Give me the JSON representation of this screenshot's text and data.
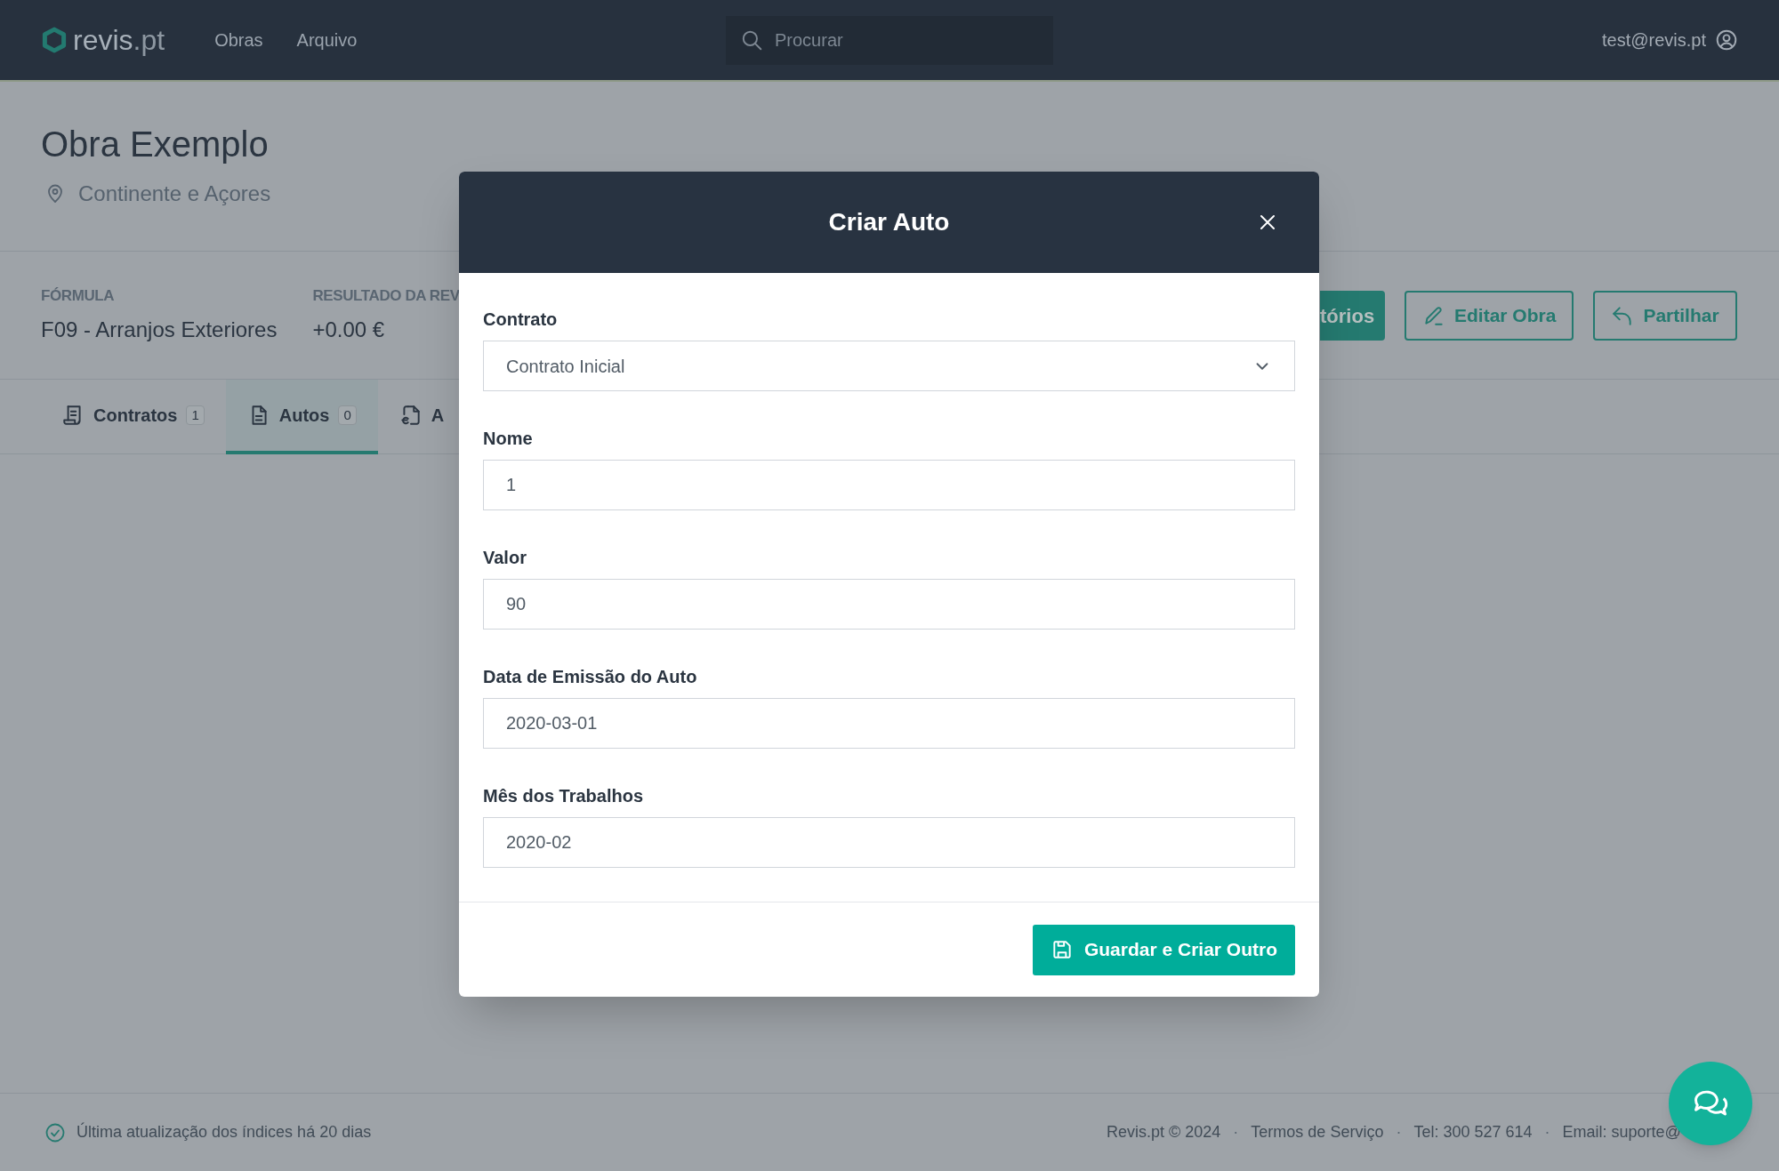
{
  "topbar": {
    "logo": {
      "name": "revis",
      "suffix": ".pt"
    },
    "nav": [
      {
        "label": "Obras"
      },
      {
        "label": "Arquivo"
      }
    ],
    "search": {
      "placeholder": "Procurar"
    },
    "user": "test@revis.pt"
  },
  "project": {
    "title": "Obra Exemplo",
    "location": "Continente e Açores",
    "stats": [
      {
        "label": "FÓRMULA",
        "value": "F09 - Arranjos Exteriores"
      },
      {
        "label": "RESULTADO DA REV",
        "value": "+0.00 €"
      }
    ],
    "actions": [
      {
        "kind": "solid",
        "label": "tórios"
      },
      {
        "kind": "edit",
        "label": "Editar Obra"
      },
      {
        "kind": "share",
        "label": "Partilhar"
      }
    ]
  },
  "tabs": [
    {
      "label": "Contratos",
      "count": "1",
      "selected": false
    },
    {
      "label": "Autos",
      "count": "0",
      "selected": true
    },
    {
      "label": "A",
      "selected": false
    }
  ],
  "modal": {
    "title": "Criar Auto",
    "fields": [
      {
        "kind": "select",
        "label": "Contrato",
        "value": "Contrato Inicial"
      },
      {
        "kind": "input",
        "label": "Nome",
        "value": "1"
      },
      {
        "kind": "input",
        "label": "Valor",
        "value": "90"
      },
      {
        "kind": "input",
        "label": "Data de Emissão do Auto",
        "value": "2020-03-01"
      },
      {
        "kind": "input",
        "label": "Mês dos Trabalhos",
        "value": "2020-02"
      }
    ],
    "submit": "Guardar e Criar Outro"
  },
  "footer": {
    "status": "Última atualização dos índices há 20 dias",
    "items": [
      {
        "kind": "text",
        "text": "Revis.pt © 2024"
      },
      {
        "kind": "separator",
        "text": "·"
      },
      {
        "kind": "link",
        "text": "Termos de Serviço"
      },
      {
        "kind": "separator",
        "text": "·"
      },
      {
        "kind": "text",
        "text": "Tel: 300 527 614"
      },
      {
        "kind": "separator",
        "text": "·"
      },
      {
        "kind": "text",
        "text": "Email: suporte@"
      }
    ]
  }
}
